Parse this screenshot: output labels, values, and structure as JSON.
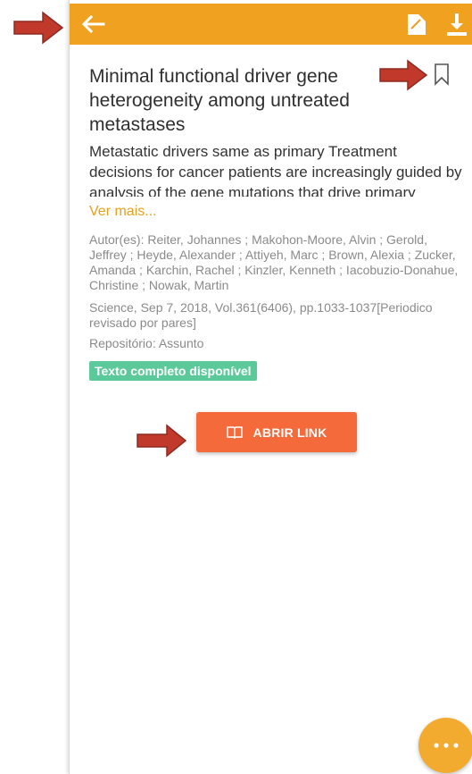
{
  "article": {
    "title": "Minimal functional driver gene heterogeneity among untreated metastases",
    "abstract": "Metastatic drivers same as primary Treatment decisions for cancer patients are increasingly guided by analysis of the gene mutations that drive primary",
    "see_more": "Ver mais...",
    "authors": "Autor(es): Reiter, Johannes ; Makohon-Moore, Alvin ; Gerold, Jeffrey ; Heyde, Alexander ; Attiyeh, Marc ; Brown, Alexia ; Zucker, Amanda ; Karchin, Rachel ; Kinzler, Kenneth ; Iacobuzio-Donahue, Christine ; Nowak, Martin",
    "source": "Science, Sep 7, 2018, Vol.361(6406), pp.1033-1037[Periodico revisado por pares]",
    "repository": "Repositório: Assunto",
    "badge": "Texto completo disponível"
  },
  "actions": {
    "open_link": "ABRIR LINK"
  },
  "icons": {
    "back": "arrow-left-icon",
    "document": "document-edit-icon",
    "download": "download-icon",
    "bookmark": "bookmark-icon",
    "book": "book-open-icon",
    "more": "more-dots-icon"
  },
  "colors": {
    "topbar": "#efa11f",
    "accent_link": "#e5a11e",
    "badge": "#5cc99a",
    "button": "#f56a3a",
    "fab": "#f3ab2f",
    "annotation_arrow": "#c0392b"
  }
}
